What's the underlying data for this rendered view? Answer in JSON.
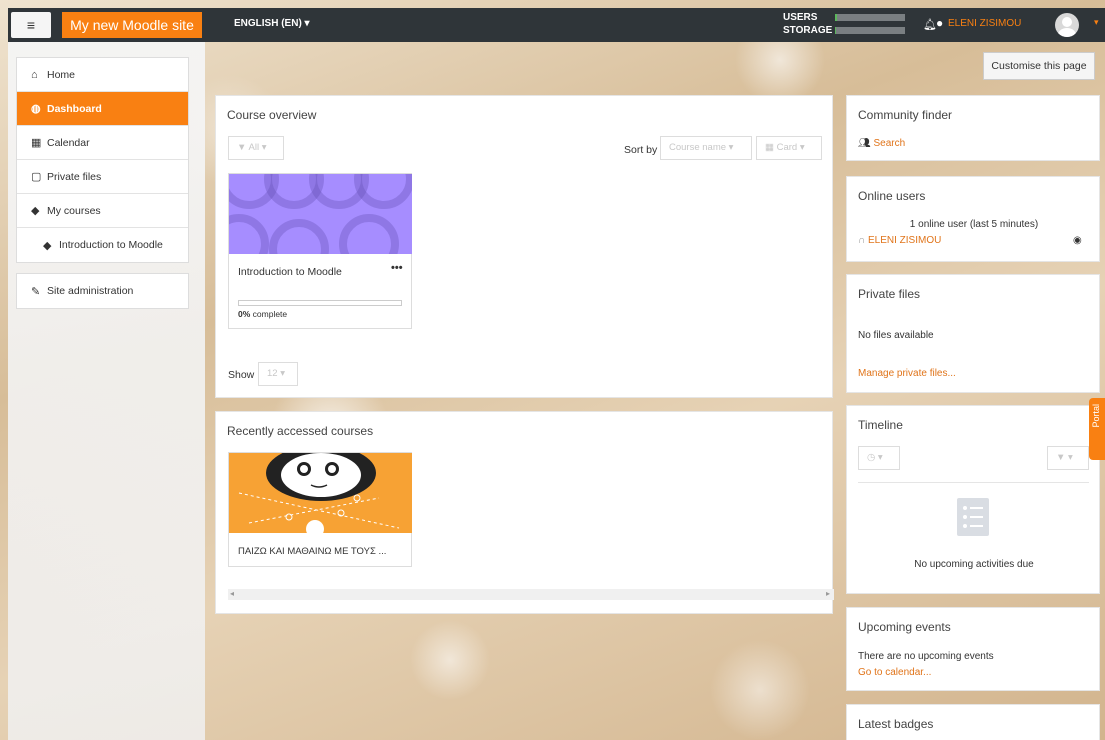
{
  "navbar": {
    "menu_icon": "hamburger-icon",
    "brand": "My new Moodle site",
    "language": "ENGLISH (EN) ▾",
    "usage": [
      {
        "label": "USERS",
        "fraction": 0.03
      },
      {
        "label": "STORAGE",
        "fraction": 0.02
      }
    ],
    "user_name": "ELENI ZISIMOU",
    "colors": {
      "brand": "#f98012",
      "navbar": "#2f3539"
    }
  },
  "sidebar": {
    "items": [
      {
        "label": "Home",
        "icon": "home-icon",
        "glyph": "⌂"
      },
      {
        "label": "Dashboard",
        "icon": "dashboard-icon",
        "glyph": "◍"
      },
      {
        "label": "Calendar",
        "icon": "calendar-icon",
        "glyph": "▦"
      },
      {
        "label": "Private files",
        "icon": "file-icon",
        "glyph": "▢"
      },
      {
        "label": "My courses",
        "icon": "graduation-cap-icon",
        "glyph": "🎓"
      },
      {
        "label": "Introduction to Moodle",
        "icon": "graduation-cap-icon",
        "glyph": "🎓"
      }
    ],
    "admin": {
      "label": "Site administration",
      "icon": "wrench-icon",
      "glyph": "🔧"
    }
  },
  "customise_label": "Customise this page",
  "course_overview": {
    "title": "Course overview",
    "filter": "All ▾",
    "sort_label": "Sort by",
    "sort_value": "Course name ▾",
    "view_value": "Card ▾",
    "course": {
      "name": "Introduction to Moodle",
      "menu": "•••",
      "progress": 0,
      "progress_bold": "0%",
      "progress_rest": " complete"
    },
    "show_label": "Show",
    "show_value": "12 ▾"
  },
  "recent": {
    "title": "Recently accessed courses",
    "course_name": "ΠΑΙΖΩ ΚΑΙ ΜΑΘΑΙΝΩ ΜΕ ΤΟΥΣ ..."
  },
  "community": {
    "title": "Community finder",
    "link": "Search"
  },
  "online": {
    "title": "Online users",
    "summary": "1 online user (last 5 minutes)",
    "user": "ELENI ZISIMOU"
  },
  "private_files": {
    "title": "Private files",
    "empty": "No files available",
    "link": "Manage private files..."
  },
  "timeline": {
    "title": "Timeline",
    "empty": "No upcoming activities due"
  },
  "upcoming": {
    "title": "Upcoming events",
    "empty": "There are no upcoming events",
    "link": "Go to calendar..."
  },
  "badges": {
    "title": "Latest badges"
  },
  "portal_tab": "Portal"
}
